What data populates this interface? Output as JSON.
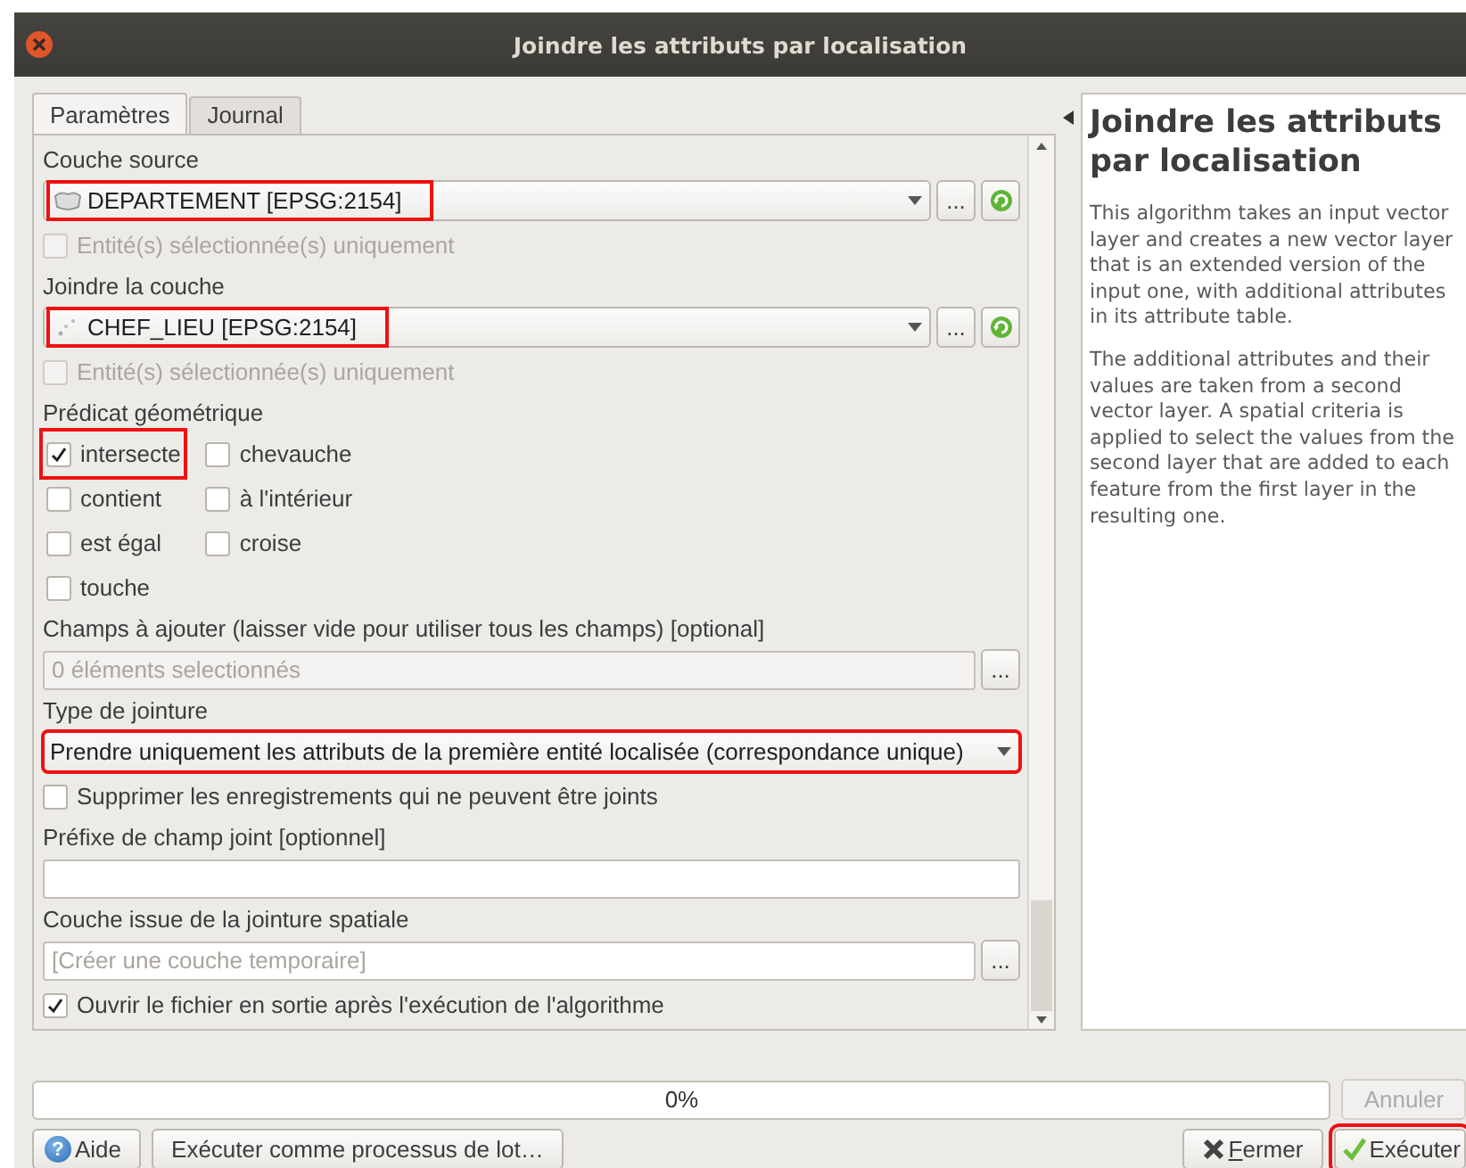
{
  "window": {
    "title": "Joindre les attributs par localisation"
  },
  "tabs": [
    {
      "label": "Paramètres",
      "selected": true
    },
    {
      "label": "Journal",
      "selected": false
    }
  ],
  "source_layer": {
    "label": "Couche source",
    "value": "DEPARTEMENT [EPSG:2154]",
    "kind": "polygon",
    "highlighted": true,
    "button": "...",
    "selected_only": {
      "label": "Entité(s) sélectionnée(s) uniquement",
      "checked": false,
      "disabled": true
    }
  },
  "join_layer": {
    "label": "Joindre la couche",
    "value": "CHEF_LIEU [EPSG:2154]",
    "kind": "point",
    "highlighted": true,
    "button": "...",
    "selected_only": {
      "label": "Entité(s) sélectionnée(s) uniquement",
      "checked": false,
      "disabled": true
    }
  },
  "predicate": {
    "label": "Prédicat géométrique",
    "options": [
      {
        "label": "intersecte",
        "checked": true,
        "highlighted": true
      },
      {
        "label": "chevauche",
        "checked": false,
        "highlighted": false
      },
      {
        "label": "contient",
        "checked": false,
        "highlighted": false
      },
      {
        "label": "à l'intérieur",
        "checked": false,
        "highlighted": false
      },
      {
        "label": "est égal",
        "checked": false,
        "highlighted": false
      },
      {
        "label": "croise",
        "checked": false,
        "highlighted": false
      },
      {
        "label": "touche",
        "checked": false,
        "highlighted": false
      }
    ]
  },
  "fields_to_add": {
    "label": "Champs à ajouter (laisser vide pour utiliser tous les champs) [optional]",
    "placeholder": "0 éléments selectionnés",
    "button": "..."
  },
  "join_type": {
    "label": "Type de jointure",
    "value": "Prendre uniquement les attributs de la première entité localisée (correspondance unique)",
    "highlighted": true
  },
  "discard": {
    "label": "Supprimer les enregistrements qui ne peuvent être joints",
    "checked": false
  },
  "prefix": {
    "label": "Préfixe de champ joint [optionnel]"
  },
  "output": {
    "label": "Couche issue de la jointure spatiale",
    "placeholder": "[Créer une couche temporaire]",
    "button": "..."
  },
  "open_output": {
    "label": "Ouvrir le fichier en sortie après l'exécution de l'algorithme",
    "checked": true
  },
  "help": {
    "title": "Joindre les attributs par localisation",
    "paragraphs": [
      "This algorithm takes an input vector layer and creates a new vector layer that is an extended version of the input one, with additional attributes in its attribute table.",
      "The additional attributes and their values are taken from a second vector layer. A spatial criteria is applied to select the values from the second layer that are added to each feature from the first layer in the resulting one."
    ]
  },
  "progress": {
    "level": 0,
    "reading": "0%",
    "cancel": "Annuler"
  },
  "buttons": {
    "help": {
      "label": "Aide",
      "glyph": "?"
    },
    "batch": "Exécuter comme processus de lot…",
    "close": "Fermer",
    "run": {
      "label": "Exécuter",
      "highlighted": true
    }
  }
}
